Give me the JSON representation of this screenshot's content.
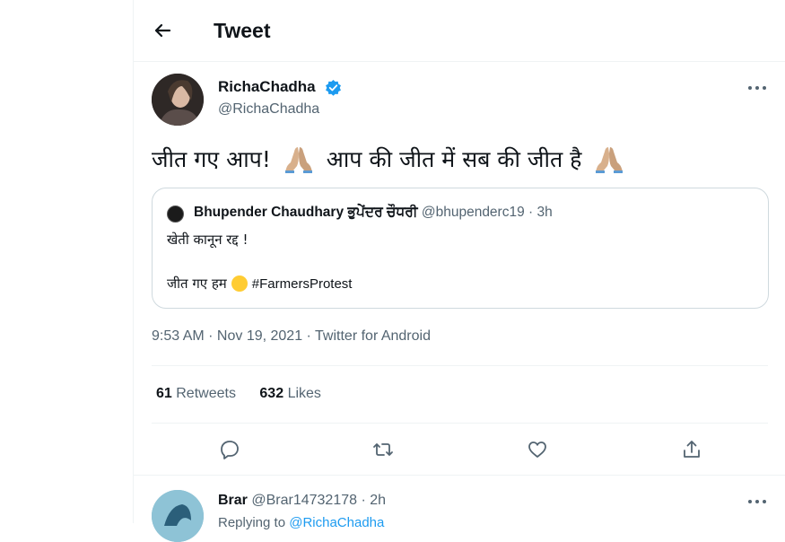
{
  "header": {
    "title": "Tweet"
  },
  "tweet": {
    "author_name": "RichaChadha",
    "author_handle": "@RichaChadha",
    "text_part1": "जीत गए आप!",
    "text_part2": "आप की जीत में सब की जीत है",
    "timestamp": "9:53 AM · Nov 19, 2021 · Twitter for Android",
    "retweets": "61",
    "retweets_label": "Retweets",
    "likes": "632",
    "likes_label": "Likes"
  },
  "quote": {
    "name": "Bhupender Chaudhary ਭੁਪੇਂਦਰ ਚੌਧਰੀ",
    "meta": "@bhupenderc19 · 3h",
    "line1": "खेती कानून रद्द !",
    "line2_text": "जीत गए हम",
    "hashtag": "#FarmersProtest"
  },
  "reply": {
    "name": "Brar",
    "meta": "@Brar14732178 · 2h",
    "replying_prefix": "Replying to",
    "replying_handle": "@RichaChadha"
  },
  "icons": {
    "back": "back-arrow-icon",
    "verified": "verified-badge-icon",
    "more": "more-options-icon",
    "emoji": "folded-hands-emoji",
    "reply": "reply-icon",
    "retweet": "retweet-icon",
    "like": "heart-icon",
    "share": "share-icon"
  },
  "colors": {
    "accent": "#1d9bf0",
    "secondary_text": "#536471",
    "border": "#eff3f4"
  }
}
